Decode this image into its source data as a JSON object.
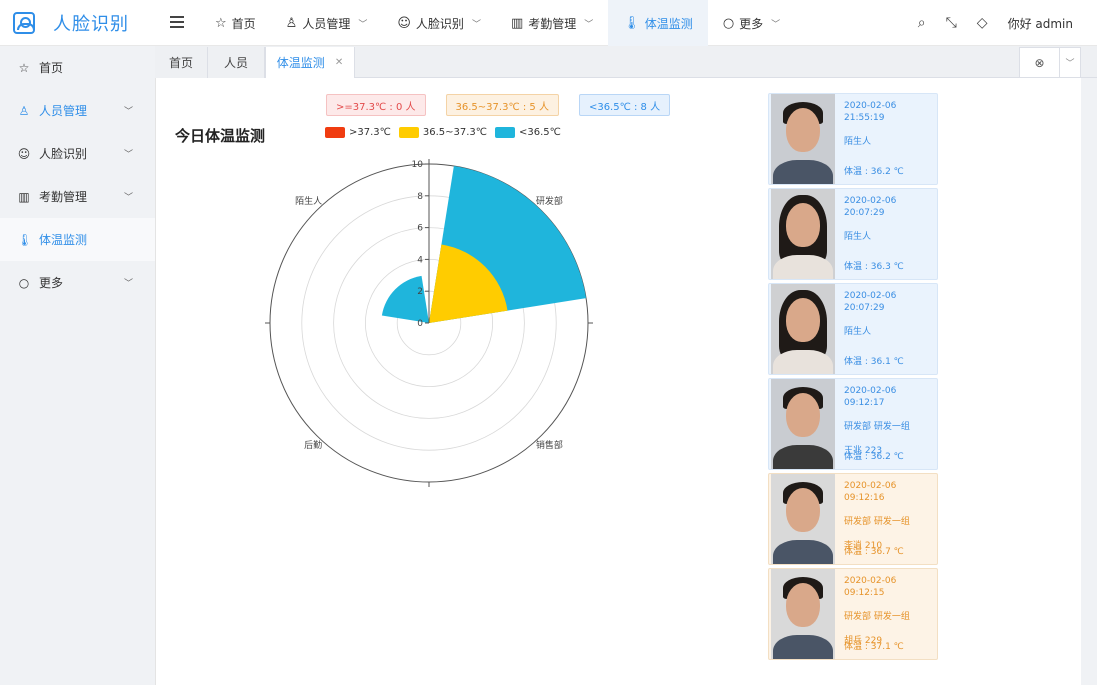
{
  "app": {
    "title": "人脸识别"
  },
  "topnav": {
    "items": [
      {
        "label": "首页",
        "icon": "star-icon"
      },
      {
        "label": "人员管理",
        "icon": "user-icon"
      },
      {
        "label": "人脸识别",
        "icon": "smile-icon"
      },
      {
        "label": "考勤管理",
        "icon": "bar-chart-icon"
      },
      {
        "label": "体温监测",
        "icon": "thermometer-icon"
      },
      {
        "label": "更多",
        "icon": "circle-icon"
      }
    ],
    "greeting": "你好 admin"
  },
  "sidebar": {
    "items": [
      {
        "label": "首页"
      },
      {
        "label": "人员管理"
      },
      {
        "label": "人脸识别"
      },
      {
        "label": "考勤管理"
      },
      {
        "label": "体温监测"
      },
      {
        "label": "更多"
      }
    ]
  },
  "tabs": [
    {
      "label": "首页"
    },
    {
      "label": "人员"
    },
    {
      "label": "体温监测"
    }
  ],
  "badges": {
    "high": ">=37.3℃ : 0 人",
    "mid": "36.5~37.3℃ : 5 人",
    "low": "<36.5℃ : 8 人"
  },
  "colors": {
    "high": "#f03c10",
    "mid": "#ffcc00",
    "low": "#1fb5dc",
    "accent": "#2f8ee8"
  },
  "chart_data": {
    "type": "polar-bar",
    "title": "今日体温监测",
    "legend": [
      ">37.3℃",
      "36.5~37.3℃",
      "<36.5℃"
    ],
    "radial_ticks": [
      "0",
      "2",
      "4",
      "6",
      "8",
      "10"
    ],
    "rmax": 10,
    "categories": [
      "研发部",
      "销售部",
      "后勤",
      "陌生人"
    ],
    "series": [
      {
        "name": ">37.3℃",
        "values": [
          0,
          0,
          0,
          0
        ]
      },
      {
        "name": "36.5~37.3℃",
        "values": [
          5,
          0,
          0,
          0
        ]
      },
      {
        "name": "<36.5℃",
        "values": [
          10,
          0,
          0,
          3
        ]
      }
    ]
  },
  "feed": [
    {
      "time": "2020-02-06 21:55:19",
      "line1": "陌生人",
      "line2": "",
      "temp": "体温 : 36.2 ℃",
      "tone": "blue",
      "gender": "m"
    },
    {
      "time": "2020-02-06 20:07:29",
      "line1": "陌生人",
      "line2": "",
      "temp": "体温 : 36.3 ℃",
      "tone": "blue",
      "gender": "f"
    },
    {
      "time": "2020-02-06 20:07:29",
      "line1": "陌生人",
      "line2": "",
      "temp": "体温 : 36.1 ℃",
      "tone": "blue",
      "gender": "f"
    },
    {
      "time": "2020-02-06 09:12:17",
      "line1": "研发部  研发一组",
      "line2": "王兆  223",
      "temp": "体温 : 36.2 ℃",
      "tone": "blue",
      "gender": "m"
    },
    {
      "time": "2020-02-06 09:12:16",
      "line1": "研发部  研发一组",
      "line2": "李逍  210",
      "temp": "体温 : 36.7 ℃",
      "tone": "orange",
      "gender": "m"
    },
    {
      "time": "2020-02-06 09:12:15",
      "line1": "研发部  研发一组",
      "line2": "胡兵  229",
      "temp": "体温 : 37.1 ℃",
      "tone": "orange",
      "gender": "m"
    }
  ]
}
